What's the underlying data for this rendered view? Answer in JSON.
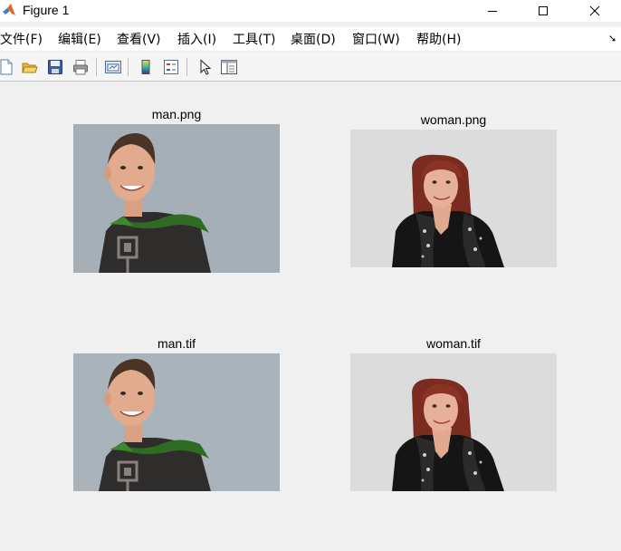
{
  "window": {
    "title": "Figure 1"
  },
  "menu": {
    "items": [
      "文件(F)",
      "编辑(E)",
      "查看(V)",
      "插入(I)",
      "工具(T)",
      "桌面(D)",
      "窗口(W)",
      "帮助(H)"
    ]
  },
  "toolbar": {
    "buttons": [
      "new-figure-icon",
      "open-file-icon",
      "save-icon",
      "print-icon",
      "link-plot-icon",
      "insert-colorbar-icon",
      "insert-legend-icon",
      "edit-plot-cursor-icon",
      "property-inspector-icon"
    ]
  },
  "figure": {
    "axes": [
      {
        "title": "man.png",
        "image": "man"
      },
      {
        "title": "woman.png",
        "image": "woman"
      },
      {
        "title": "man.tif",
        "image": "man"
      },
      {
        "title": "woman.tif",
        "image": "woman"
      }
    ]
  },
  "colors": {
    "window_bg": "#f0f0f0",
    "titlebar_bg": "#ffffff",
    "man_background": "#a9b3bb",
    "woman_background": "#dcdcdc"
  }
}
